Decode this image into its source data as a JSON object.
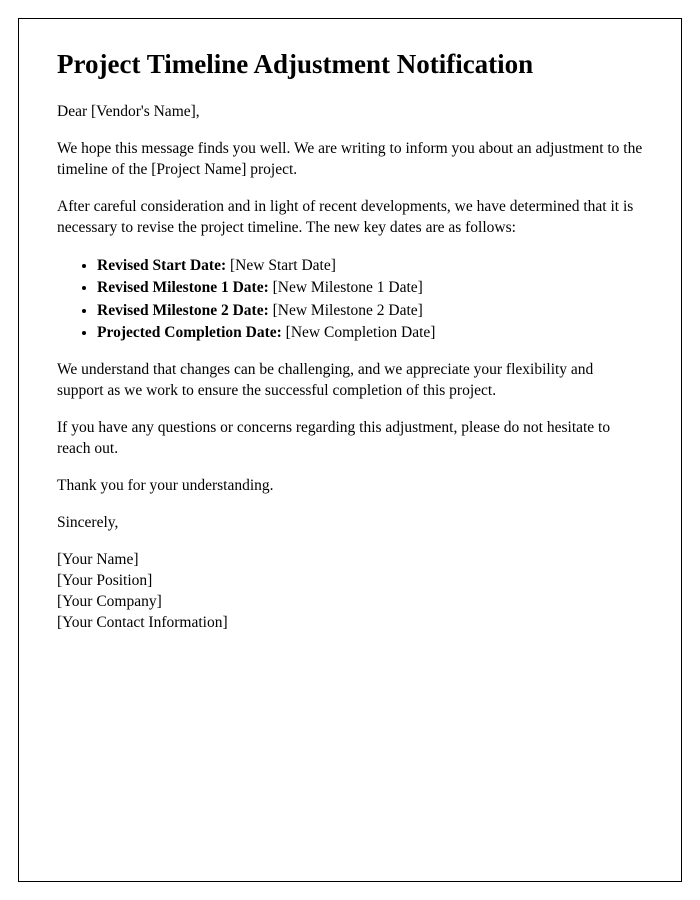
{
  "title": "Project Timeline Adjustment Notification",
  "salutation": "Dear [Vendor's Name],",
  "paragraph1": "We hope this message finds you well. We are writing to inform you about an adjustment to the timeline of the [Project Name] project.",
  "paragraph2": "After careful consideration and in light of recent developments, we have determined that it is necessary to revise the project timeline. The new key dates are as follows:",
  "dates": [
    {
      "label": "Revised Start Date:",
      "value": " [New Start Date]"
    },
    {
      "label": "Revised Milestone 1 Date:",
      "value": " [New Milestone 1 Date]"
    },
    {
      "label": "Revised Milestone 2 Date:",
      "value": " [New Milestone 2 Date]"
    },
    {
      "label": "Projected Completion Date:",
      "value": " [New Completion Date]"
    }
  ],
  "paragraph3": "We understand that changes can be challenging, and we appreciate your flexibility and support as we work to ensure the successful completion of this project.",
  "paragraph4": "If you have any questions or concerns regarding this adjustment, please do not hesitate to reach out.",
  "paragraph5": "Thank you for your understanding.",
  "closing": "Sincerely,",
  "signature": {
    "name": "[Your Name]",
    "position": "[Your Position]",
    "company": "[Your Company]",
    "contact": "[Your Contact Information]"
  }
}
